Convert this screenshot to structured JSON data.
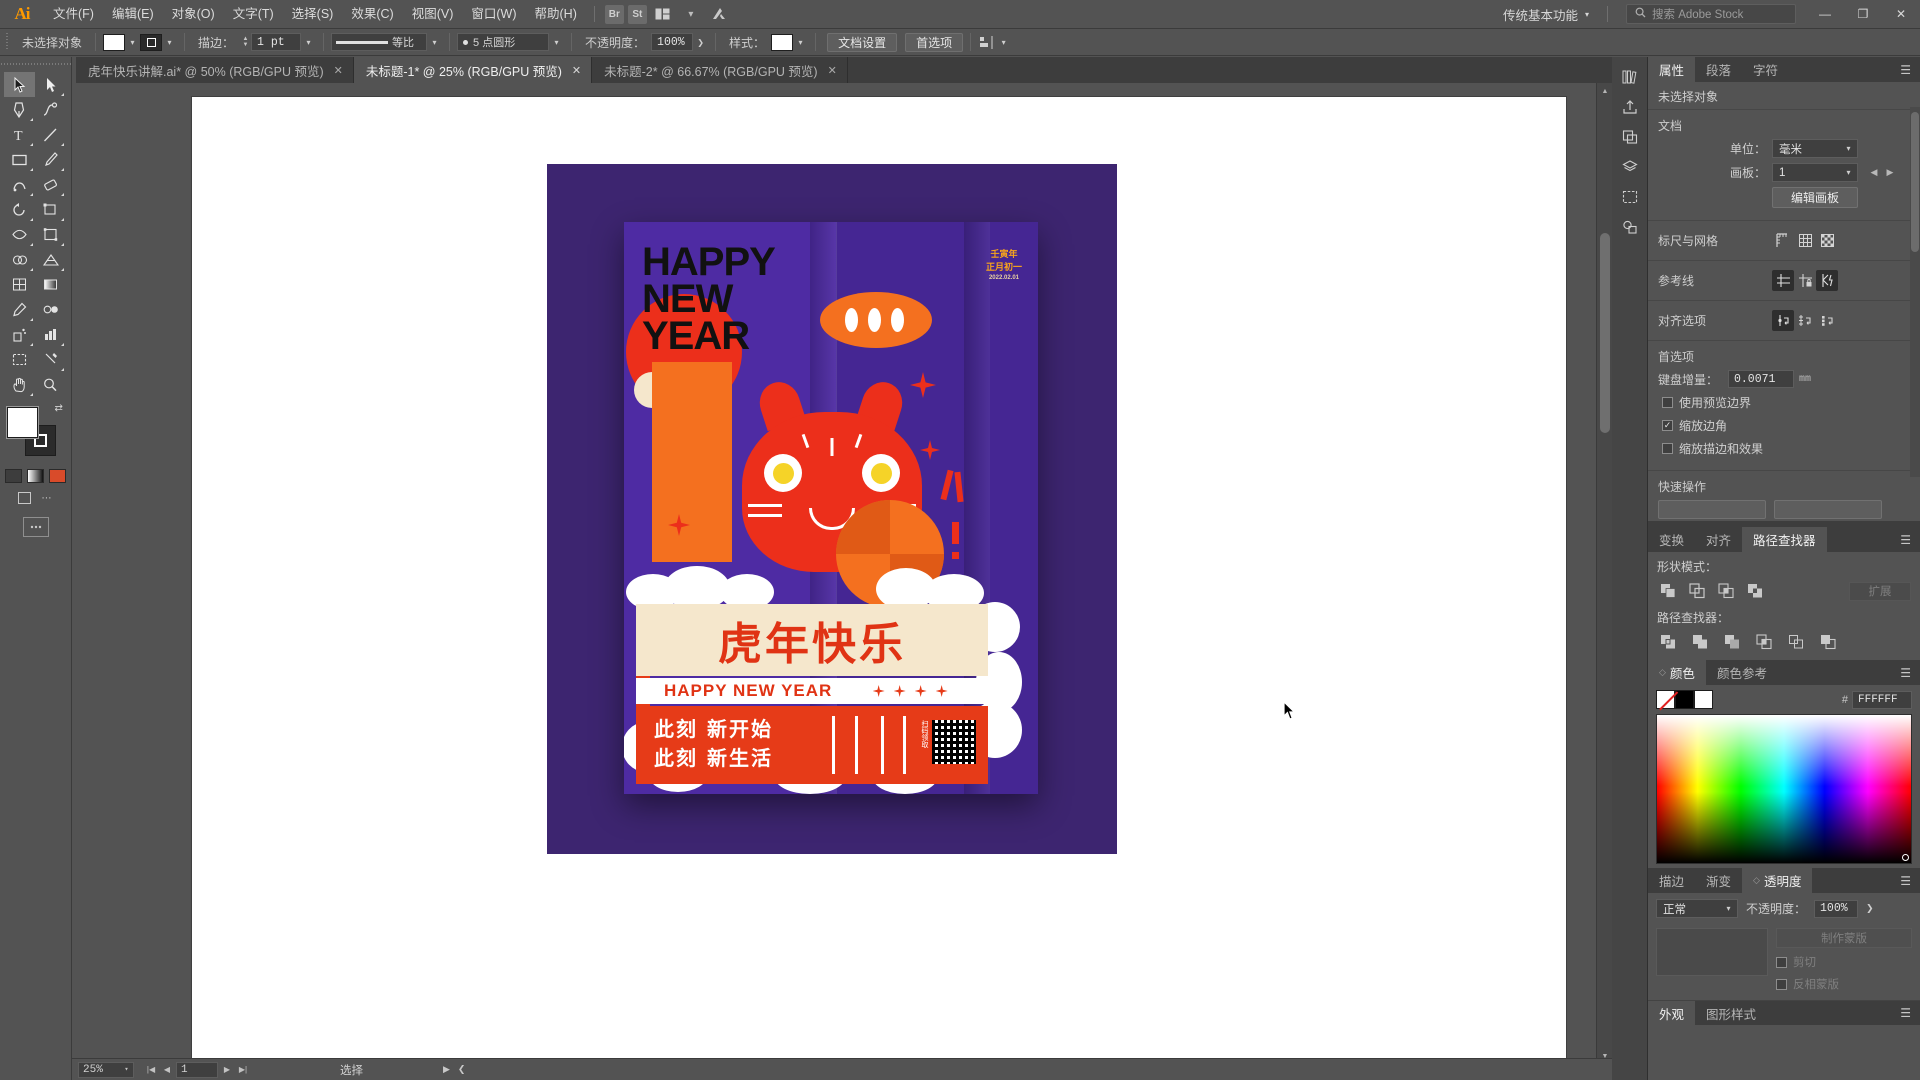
{
  "app": {
    "name": "Adobe Illustrator",
    "logo_text": "Ai"
  },
  "menubar": {
    "items": [
      {
        "label": "文件(F)"
      },
      {
        "label": "编辑(E)"
      },
      {
        "label": "对象(O)"
      },
      {
        "label": "文字(T)"
      },
      {
        "label": "选择(S)"
      },
      {
        "label": "效果(C)"
      },
      {
        "label": "视图(V)"
      },
      {
        "label": "窗口(W)"
      },
      {
        "label": "帮助(H)"
      }
    ],
    "bridge_label": "Br",
    "stock_label": "St",
    "arrange_icon": "arrange-documents-icon",
    "workspace": "传统基本功能",
    "search_placeholder": "搜索 Adobe Stock",
    "window_buttons": {
      "minimize": "—",
      "restore": "❐",
      "close": "✕"
    }
  },
  "controlbar": {
    "selection_status": "未选择对象",
    "fill_swatch": "#FFFFFF",
    "stroke_swatch_label": "stroke-none",
    "stroke_label": "描边：",
    "stroke_weight": "1 pt",
    "stroke_profile": "等比",
    "brush_label": "5 点圆形",
    "opacity_label": "不透明度：",
    "opacity_value": "100%",
    "style_label": "样式：",
    "doc_setup_button": "文档设置",
    "preferences_button": "首选项",
    "arrange_label": "arrange-icon"
  },
  "tabs": [
    {
      "title": "虎年快乐讲解.ai* @ 50% (RGB/GPU 预览)",
      "active": false,
      "close": "✕"
    },
    {
      "title": "未标题-1* @ 25% (RGB/GPU 预览)",
      "active": true,
      "close": "✕"
    },
    {
      "title": "未标题-2* @ 66.67% (RGB/GPU 预览)",
      "active": false,
      "close": "✕"
    }
  ],
  "toolbar": {
    "tools": [
      {
        "name": "selection-tool",
        "active": true
      },
      {
        "name": "direct-selection-tool",
        "active": false
      },
      {
        "name": "pen-tool",
        "active": false
      },
      {
        "name": "curvature-tool",
        "active": false
      },
      {
        "name": "type-tool",
        "active": false
      },
      {
        "name": "line-segment-tool",
        "active": false
      },
      {
        "name": "rectangle-tool",
        "active": false
      },
      {
        "name": "paintbrush-tool",
        "active": false
      },
      {
        "name": "shaper-tool",
        "active": false
      },
      {
        "name": "eraser-tool",
        "active": false
      },
      {
        "name": "rotate-tool",
        "active": false
      },
      {
        "name": "scale-tool",
        "active": false
      },
      {
        "name": "width-tool",
        "active": false
      },
      {
        "name": "free-transform-tool",
        "active": false
      },
      {
        "name": "shape-builder-tool",
        "active": false
      },
      {
        "name": "perspective-grid-tool",
        "active": false
      },
      {
        "name": "mesh-tool",
        "active": false
      },
      {
        "name": "gradient-tool",
        "active": false
      },
      {
        "name": "eyedropper-tool",
        "active": false
      },
      {
        "name": "blend-tool",
        "active": false
      },
      {
        "name": "symbol-sprayer-tool",
        "active": false
      },
      {
        "name": "column-graph-tool",
        "active": false
      },
      {
        "name": "artboard-tool",
        "active": false
      },
      {
        "name": "slice-tool",
        "active": false
      },
      {
        "name": "hand-tool",
        "active": false
      },
      {
        "name": "zoom-tool",
        "active": false
      }
    ],
    "fill_color": "#FFFFFF",
    "stroke_color": "#000000",
    "screen_modes": [
      "normal-screen-mode",
      "full-screen-menu-mode",
      "full-screen-mode"
    ]
  },
  "canvas": {
    "artboard_background": "#FFFFFF",
    "poster": {
      "background": "#3D2570",
      "headline_en": "HAPPY\nNEW\nYEAR",
      "headline_lines": [
        "HAPPY",
        "NEW",
        "YEAR"
      ],
      "banner_cn": "虎年快乐",
      "banner_en": "HAPPY NEW YEAR",
      "slogan_line1": "此刻 新开始",
      "slogan_line2": "此刻 新生活",
      "qr_label": "扫码领取",
      "qr_label2": "年货大礼包",
      "date_line1": "壬寅年",
      "date_line2": "正月初一",
      "date_line3": "2022.02.01",
      "colors": {
        "purple": "#4A2A9E",
        "red": "#EC2F1B",
        "orange": "#F4701F",
        "cream": "#F5E7CC",
        "yellow": "#F5D328",
        "white": "#FFFFFF"
      }
    }
  },
  "statusbar": {
    "zoom": "25%",
    "page": "1",
    "tool_status": "选择",
    "nav_first": "|◀",
    "nav_prev": "◀",
    "nav_next": "▶",
    "nav_last": "▶|"
  },
  "rightdock": {
    "icon_tools": [
      "libraries-icon",
      "export-icon",
      "asset-export-icon",
      "layers-icon",
      "artboards-icon",
      "symbols-icon"
    ],
    "panel_tabs": [
      {
        "label": "属性",
        "active": true
      },
      {
        "label": "段落",
        "active": false
      },
      {
        "label": "字符",
        "active": false
      }
    ],
    "properties": {
      "no_selection": "未选择对象",
      "document_title": "文档",
      "units_label": "单位：",
      "units_value": "毫米",
      "artboard_label": "画板：",
      "artboard_value": "1",
      "edit_artboards_button": "编辑画板",
      "ruler_grid_label": "标尺与网格",
      "ruler_grid_icons": [
        "rulers-icon",
        "grid-icon",
        "transparency-grid-icon"
      ],
      "guides_label": "参考线",
      "guides_icons": [
        "show-guides-icon",
        "lock-guides-icon",
        "smart-guides-icon"
      ],
      "align_label": "对齐选项",
      "align_icons": [
        "snap-to-point-icon",
        "snap-to-grid-icon",
        "snap-to-pixel-icon"
      ],
      "preferences_title": "首选项",
      "keyboard_increment_label": "键盘增量：",
      "keyboard_increment_value": "0.0071",
      "keyboard_increment_unit": "mm",
      "check_preview_bounds": "使用预览边界",
      "check_scale_corners": "缩放边角",
      "check_scale_strokes": "缩放描边和效果",
      "quick_actions_title": "快速操作"
    },
    "pathfinder_panel": {
      "tabs": [
        {
          "label": "变换",
          "active": false
        },
        {
          "label": "对齐",
          "active": false
        },
        {
          "label": "路径查找器",
          "active": true
        }
      ],
      "shape_modes_label": "形状模式：",
      "shape_mode_icons": [
        "unite-icon",
        "minus-front-icon",
        "intersect-icon",
        "exclude-icon"
      ],
      "expand_button": "扩展",
      "pathfinders_label": "路径查找器：",
      "pathfinder_icons": [
        "divide-icon",
        "trim-icon",
        "merge-icon",
        "crop-icon",
        "outline-icon",
        "minus-back-icon"
      ]
    },
    "color_panel": {
      "tabs": [
        {
          "label": "颜色",
          "active": true
        },
        {
          "label": "颜色参考",
          "active": false
        }
      ],
      "swatches": [
        "none",
        "#000000",
        "#FFFFFF"
      ],
      "hex_symbol": "#",
      "hex_value": "FFFFFF"
    },
    "transparency_panel": {
      "tabs": [
        {
          "label": "描边",
          "active": false
        },
        {
          "label": "渐变",
          "active": false
        },
        {
          "label": "透明度",
          "active": true
        }
      ],
      "blend_mode": "正常",
      "opacity_label": "不透明度：",
      "opacity_value": "100%",
      "make_mask_button": "制作蒙版",
      "clip_checkbox": "剪切",
      "invert_mask_checkbox": "反相蒙版"
    },
    "appearance_panel": {
      "tabs": [
        {
          "label": "外观",
          "active": true
        },
        {
          "label": "图形样式",
          "active": false
        }
      ]
    }
  }
}
